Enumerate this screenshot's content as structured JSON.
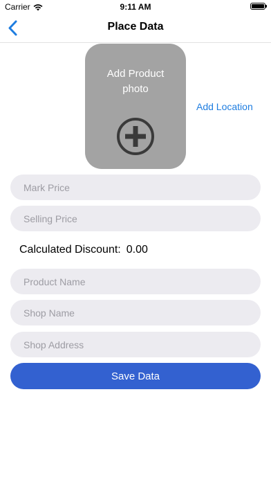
{
  "status_bar": {
    "carrier": "Carrier",
    "time": "9:11 AM"
  },
  "nav": {
    "title": "Place Data",
    "back_icon": "chevron-left-icon"
  },
  "photo": {
    "label": "Add Product\nphoto",
    "icon": "plus-circle-icon"
  },
  "location": {
    "label": "Add Location"
  },
  "fields": {
    "mark_price": {
      "placeholder": "Mark Price",
      "value": ""
    },
    "selling_price": {
      "placeholder": "Selling Price",
      "value": ""
    },
    "product_name": {
      "placeholder": "Product Name",
      "value": ""
    },
    "shop_name": {
      "placeholder": "Shop Name",
      "value": ""
    },
    "shop_address": {
      "placeholder": "Shop Address",
      "value": ""
    }
  },
  "discount": {
    "label": "Calculated Discount:",
    "value": "0.00"
  },
  "save": {
    "label": "Save Data"
  },
  "colors": {
    "accent": "#1e7de0",
    "button": "#3361d0",
    "tile": "#a3a3a3",
    "field_bg": "#ecebf0",
    "placeholder": "#9d9ca3"
  }
}
